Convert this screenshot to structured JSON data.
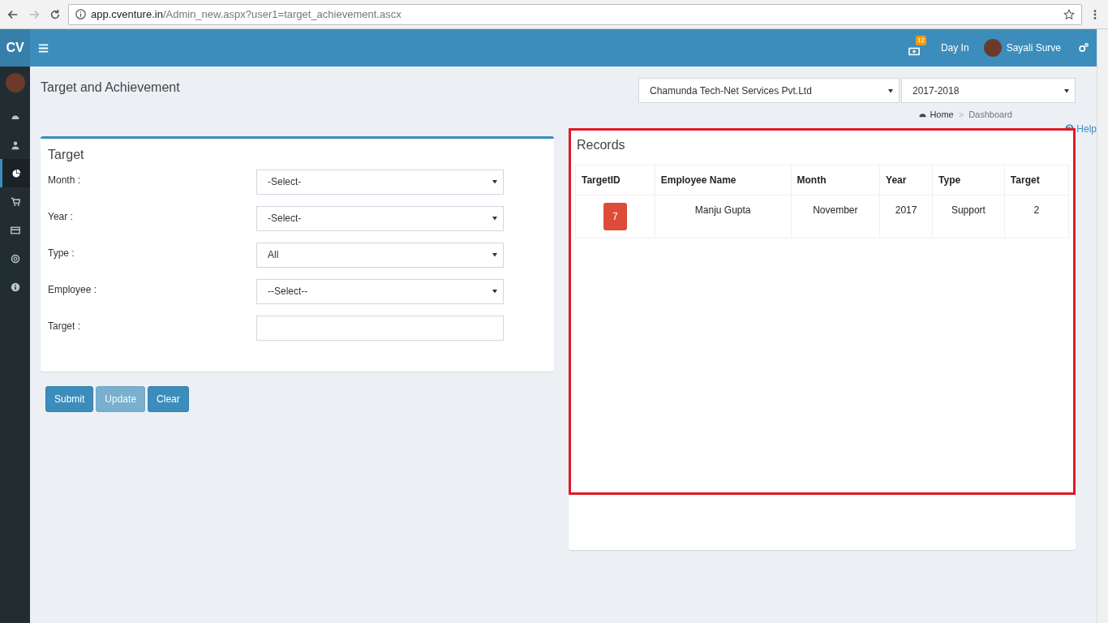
{
  "browser": {
    "url_host": "app.cventure.in",
    "url_path": "/Admin_new.aspx?user1=target_achievement.ascx"
  },
  "header": {
    "logo": "CV",
    "notification_count": "12",
    "day_in": "Day In",
    "user_name": "Sayali Surve"
  },
  "sidebar": {
    "items": [
      {
        "kind": "dashboard",
        "selected": false
      },
      {
        "kind": "user",
        "selected": false
      },
      {
        "kind": "pie",
        "selected": true
      },
      {
        "kind": "cart",
        "selected": false
      },
      {
        "kind": "card",
        "selected": false
      },
      {
        "kind": "lifebuoy",
        "selected": false
      },
      {
        "kind": "info",
        "selected": false
      }
    ]
  },
  "page": {
    "title": "Target and Achievement",
    "company": "Chamunda Tech-Net Services Pvt.Ltd",
    "fiscal_year": "2017-2018",
    "breadcrumb": [
      {
        "label": "Home"
      },
      {
        "label": "Dashboard"
      }
    ],
    "breadcrumb_separator": ">",
    "help": "Help"
  },
  "target_form": {
    "title": "Target",
    "fields": [
      {
        "kind": "select",
        "label": "Month :",
        "value": "-Select-"
      },
      {
        "kind": "select",
        "label": "Year :",
        "value": "-Select-"
      },
      {
        "kind": "select",
        "label": "Type :",
        "value": "All"
      },
      {
        "kind": "select",
        "label": "Employee :",
        "value": "--Select--"
      },
      {
        "kind": "text",
        "label": "Target :"
      }
    ]
  },
  "buttons": [
    {
      "label": "Submit",
      "disabled": false
    },
    {
      "label": "Update",
      "disabled": true
    },
    {
      "label": "Clear",
      "disabled": false
    }
  ],
  "records": {
    "title": "Records",
    "highlighted": true,
    "columns": [
      "TargetID",
      "Employee Name",
      "Month",
      "Year",
      "Type",
      "Target"
    ],
    "rows": [
      [
        "7",
        "Manju Gupta",
        "November",
        "2017",
        "Support",
        "2"
      ]
    ]
  }
}
